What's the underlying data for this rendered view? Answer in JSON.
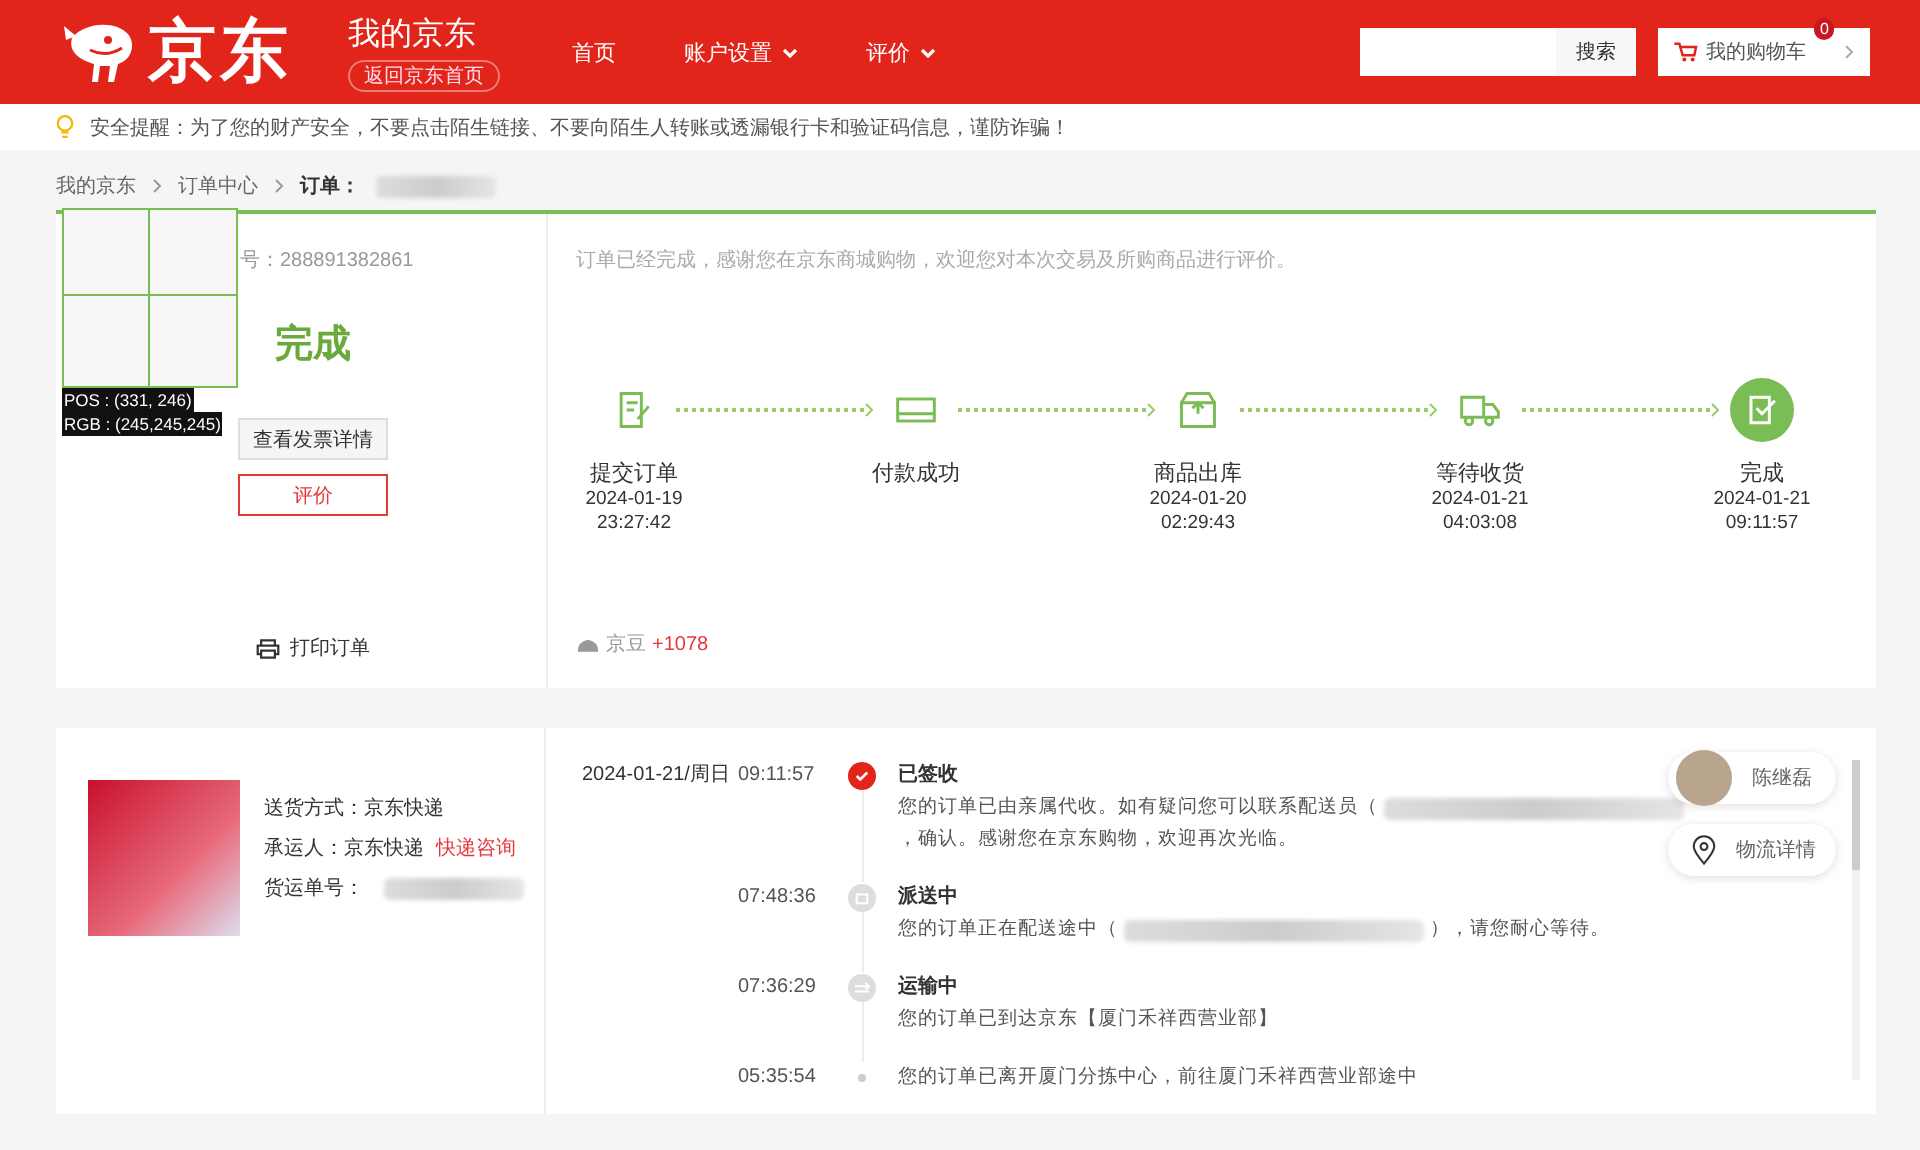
{
  "header": {
    "logo_text": "京东",
    "title": "我的京东",
    "home_link": "返回京东首页",
    "nav": [
      {
        "label": "首页",
        "dropdown": false
      },
      {
        "label": "账户设置",
        "dropdown": true
      },
      {
        "label": "评价",
        "dropdown": true
      }
    ],
    "search": {
      "button": "搜索"
    },
    "cart": {
      "label": "我的购物车",
      "count": "0"
    }
  },
  "notice": "安全提醒：为了您的财产安全，不要点击陌生链接、不要向陌生人转账或透漏银行卡和验证码信息，谨防诈骗！",
  "breadcrumb": [
    "我的京东",
    "订单中心",
    "订单："
  ],
  "picker_overlay": {
    "pos": "POS : (331, 246)",
    "rgb": "RGB : (245,245,245)"
  },
  "order": {
    "number": "号：288891382861",
    "status": "完成",
    "buttons": [
      {
        "label": "查看发票详情",
        "kind": "plain"
      },
      {
        "label": "评价",
        "kind": "outline"
      }
    ],
    "print": "打印订单",
    "message": "订单已经完成，感谢您在京东商城购物，欢迎您对本次交易及所购商品进行评价。",
    "steps": [
      {
        "label": "提交订单",
        "date": "2024-01-19",
        "time": "23:27:42",
        "kind": "submit",
        "current": false
      },
      {
        "label": "付款成功",
        "kind": "pay",
        "current": false
      },
      {
        "label": "商品出库",
        "date": "2024-01-20",
        "time": "02:29:43",
        "kind": "box",
        "current": false
      },
      {
        "label": "等待收货",
        "date": "2024-01-21",
        "time": "04:03:08",
        "kind": "truck",
        "current": false
      },
      {
        "label": "完成",
        "date": "2024-01-21",
        "time": "09:11:57",
        "kind": "done",
        "current": true
      }
    ],
    "beans": {
      "label": "京豆",
      "value": "+1078"
    }
  },
  "shipping": {
    "method": "送货方式：京东快递",
    "carrier": "承运人：京东快递",
    "carrier_link": "快递咨询",
    "waybill": "货运单号：",
    "events": [
      {
        "date": "2024-01-21/周日",
        "time": "09:11:57",
        "kind": "signed",
        "title": "已签收",
        "desc": [
          {
            "kind": "text",
            "text": "您的订单已由亲属代收。如有疑问您可以联系配送员（"
          },
          {
            "kind": "redacted"
          },
          {
            "kind": "text",
            "text": "，确认。感谢您在京东购物，欢迎再次光临。"
          }
        ]
      },
      {
        "time": "07:48:36",
        "kind": "delivering",
        "title": "派送中",
        "desc": [
          {
            "kind": "text",
            "text": "您的订单正在配送途中（"
          },
          {
            "kind": "redacted"
          },
          {
            "kind": "text",
            "text": "），请您耐心等待。"
          }
        ]
      },
      {
        "time": "07:36:29",
        "kind": "transit",
        "title": "运输中",
        "desc": [
          {
            "kind": "text",
            "text": "您的订单已到达京东【厦门禾祥西营业部】"
          }
        ]
      },
      {
        "time": "05:35:54",
        "kind": "dot",
        "desc": [
          {
            "kind": "text",
            "text": "您的订单已离开厦门分拣中心，前往厦门禾祥西营业部途中"
          }
        ]
      }
    ],
    "courier": {
      "name": "陈继磊"
    },
    "details": "物流详情"
  }
}
